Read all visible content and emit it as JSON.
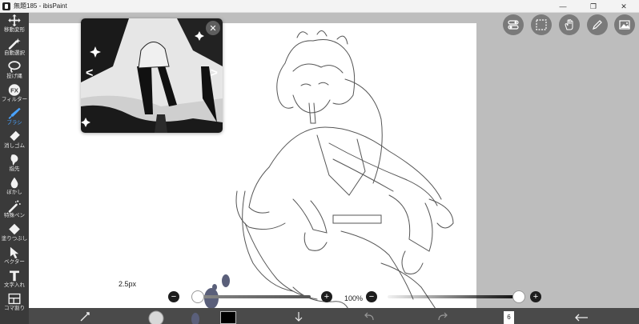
{
  "window": {
    "title": "無題185 - ibisPaint",
    "minimize_glyph": "—",
    "maximize_glyph": "❐",
    "close_glyph": "✕"
  },
  "tools": [
    {
      "name": "transform",
      "label": "移動変形",
      "icon": "move-arrows-icon",
      "active": false
    },
    {
      "name": "magic-wand",
      "label": "自動選択",
      "icon": "magic-wand-icon",
      "active": false
    },
    {
      "name": "lasso",
      "label": "投げ縄",
      "icon": "lasso-icon",
      "active": false
    },
    {
      "name": "filter",
      "label": "フィルター",
      "icon": "fx-icon",
      "active": false
    },
    {
      "name": "brush",
      "label": "ブラシ",
      "icon": "brush-icon",
      "active": true
    },
    {
      "name": "eraser",
      "label": "消しゴム",
      "icon": "eraser-icon",
      "active": false
    },
    {
      "name": "smudge",
      "label": "指先",
      "icon": "finger-icon",
      "active": false
    },
    {
      "name": "blur",
      "label": "ぼかし",
      "icon": "drop-icon",
      "active": false
    },
    {
      "name": "special-pen",
      "label": "特殊ペン",
      "icon": "sparkle-pen-icon",
      "active": false
    },
    {
      "name": "fill",
      "label": "塗りつぶし",
      "icon": "bucket-icon",
      "active": false
    },
    {
      "name": "vector",
      "label": "ベクター",
      "icon": "cursor-icon",
      "active": false
    },
    {
      "name": "text",
      "label": "文字入れ",
      "icon": "text-icon",
      "active": false
    },
    {
      "name": "frame-divider",
      "label": "コマ割り",
      "icon": "frame-icon",
      "active": false
    }
  ],
  "reference": {
    "close_glyph": "✕",
    "prev_glyph": "<",
    "next_glyph": ">"
  },
  "top_buttons": [
    "toggle-icon",
    "selection-icon",
    "hand-icon",
    "pencil-icon",
    "image-icon"
  ],
  "brush": {
    "size_label": "2.5px",
    "minus": "−",
    "plus": "+",
    "size_fraction": 0.02
  },
  "opacity": {
    "label": "100%",
    "minus": "−",
    "plus": "+",
    "fraction": 1.0
  },
  "bottom": {
    "layer_count": "6"
  },
  "colors": {
    "sidebar": "#3a3a3a",
    "active_tool": "#4aa3ff",
    "canvas_bg": "#bdbdbd",
    "paper": "#ffffff",
    "primary_color": "#000000"
  }
}
